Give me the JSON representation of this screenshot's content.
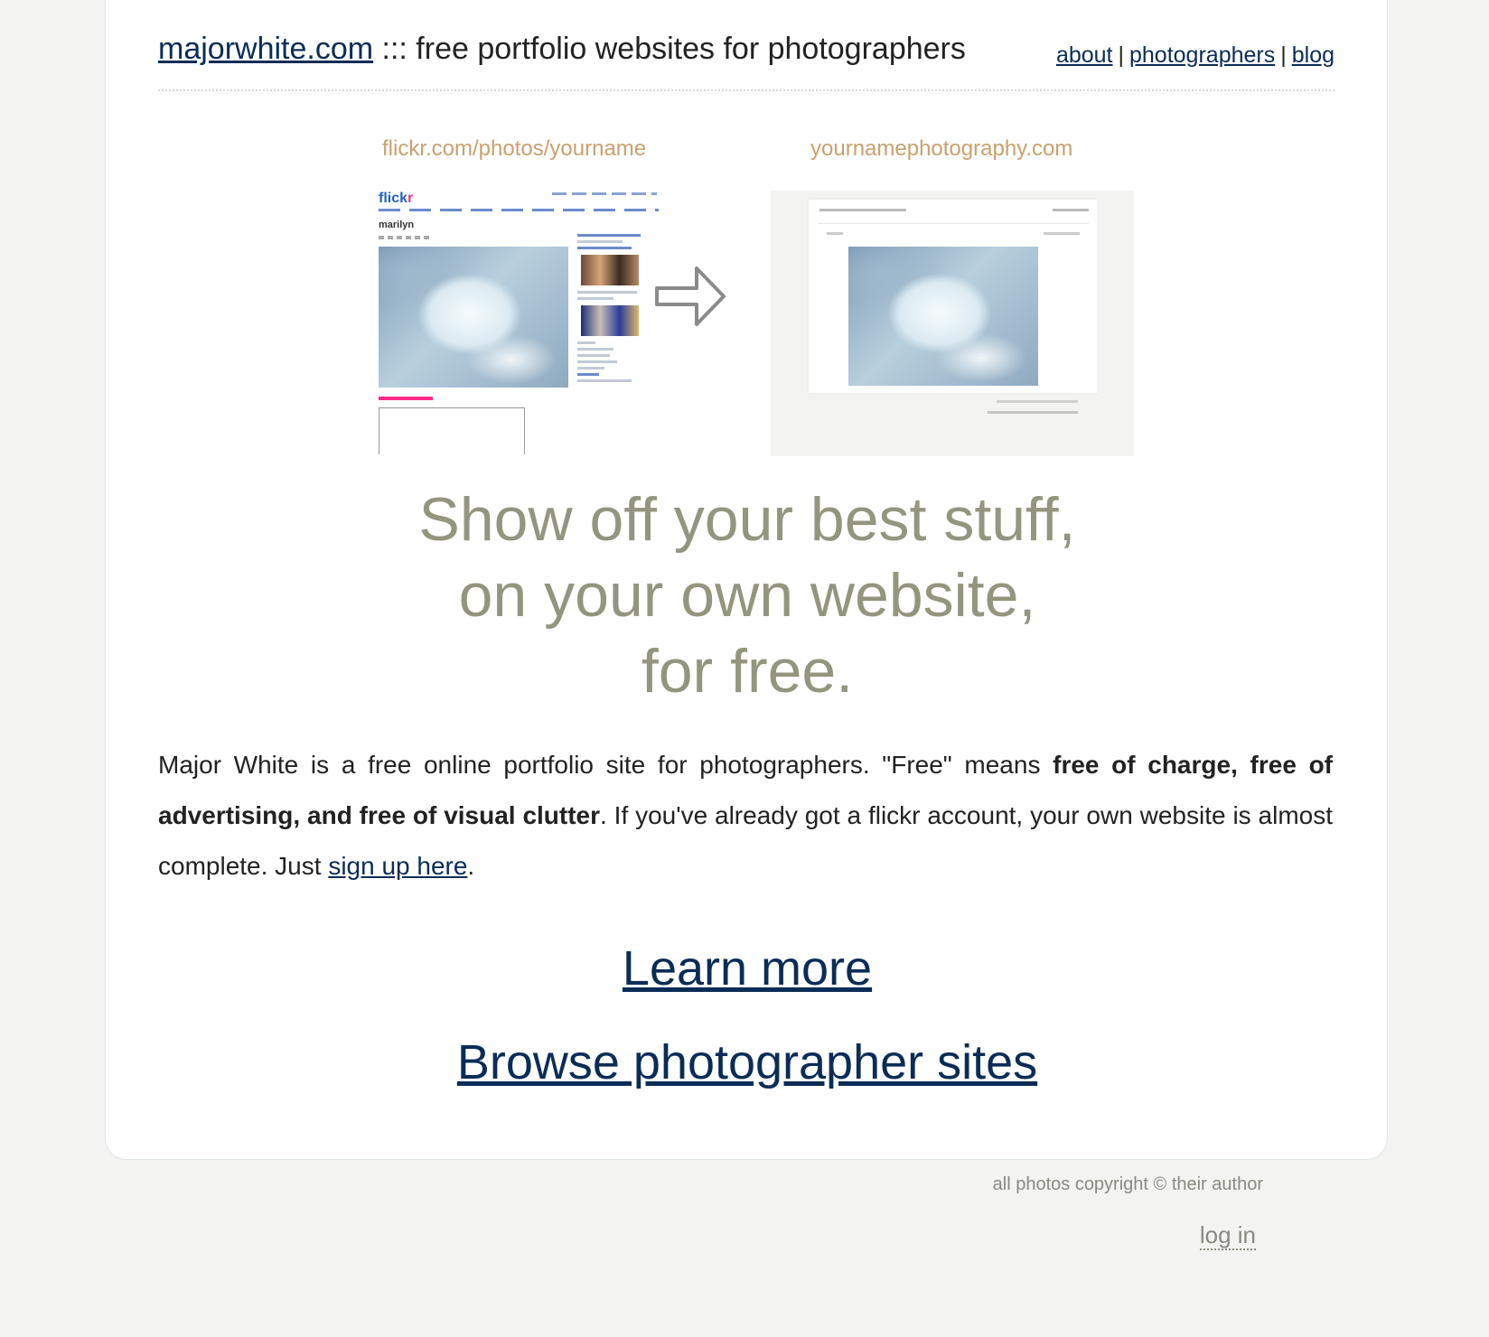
{
  "header": {
    "site_link": "majorwhite.com",
    "tagline": " ::: free portfolio websites for photographers",
    "nav": [
      {
        "label": "about"
      },
      {
        "label": "photographers"
      },
      {
        "label": "blog"
      }
    ],
    "nav_separator": "|"
  },
  "diagram": {
    "left_caption": "flickr.com/photos/yourname",
    "right_caption": "yournamephotography.com",
    "flickr_logo_main": "flick",
    "flickr_logo_accent": "r",
    "flickr_photo_title": "marilyn"
  },
  "headline": {
    "line1": "Show off your best stuff,",
    "line2": "on your own website,",
    "line3": "for free."
  },
  "intro": {
    "part1": "Major White is a free online portfolio site for photographers. \"Free\" means ",
    "bold": "free of charge, free of advertising, and free of visual clutter",
    "part2": ". If you've already got a flickr account, your own website is almost complete. Just ",
    "link": "sign up here",
    "part3": "."
  },
  "links": {
    "learn_more": "Learn more",
    "browse": "Browse photographer sites"
  },
  "footer": {
    "copyright": "all photos copyright © their author",
    "login": "log in"
  },
  "colors": {
    "background": "#f3f3f1",
    "link": "#0b2c57",
    "headline": "#94957e",
    "caption": "#c9a16e",
    "footer_text": "#888a80"
  }
}
